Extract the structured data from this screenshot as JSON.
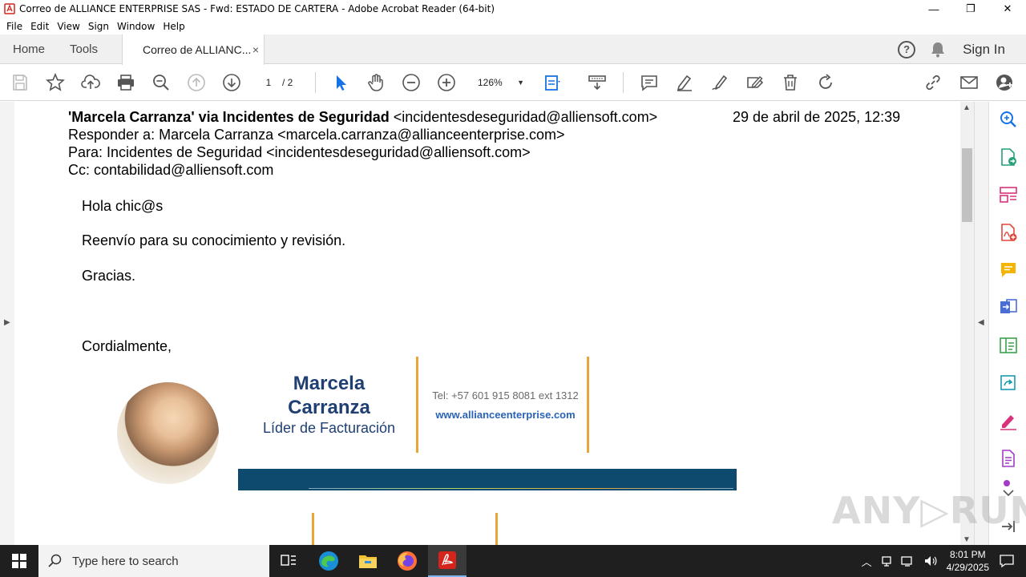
{
  "window": {
    "title": "Correo de ALLIANCE ENTERPRISE SAS - Fwd: ESTADO DE CARTERA - Adobe Acrobat Reader (64-bit)",
    "minimize": "—",
    "maximize": "❐",
    "close": "✕"
  },
  "menu": [
    "File",
    "Edit",
    "View",
    "Sign",
    "Window",
    "Help"
  ],
  "tabs": {
    "home": "Home",
    "tools": "Tools",
    "doc": "Correo de ALLIANC...",
    "close": "×"
  },
  "header": {
    "help": "?",
    "signin": "Sign In"
  },
  "toolbar": {
    "page_current": "1",
    "page_total": "/ 2",
    "zoom": "126%"
  },
  "email": {
    "from_bold": "'Marcela Carranza' via Incidentes de Seguridad",
    "from_addr": " <incidentesdeseguridad@alliensoft.com>",
    "date": "29 de abril de 2025, 12:39",
    "reply_to": "Responder a: Marcela Carranza <marcela.carranza@allianceenterprise.com>",
    "to": "Para: Incidentes de Seguridad <incidentesdeseguridad@alliensoft.com>",
    "cc": "Cc: contabilidad@alliensoft.com",
    "greeting": "Hola chic@s",
    "body": "Reenvío para su conocimiento y revisión.",
    "thanks": "Gracias.",
    "closing": "Cordialmente,"
  },
  "signature": {
    "name_line1": "Marcela",
    "name_line2": "Carranza",
    "role": "Líder de Facturación",
    "tel": "Tel: +57 601 915 8081 ext 1312",
    "web": "www.allianceenterprise.com",
    "accent_color": "#e7a53a",
    "name_color": "#1f3f73"
  },
  "watermark": "ANY▷RUN",
  "taskbar": {
    "search_placeholder": "Type here to search",
    "time": "8:01 PM",
    "date": "4/29/2025"
  },
  "colors": {
    "acrobat_red": "#d4241c",
    "toolbar_blue": "#1473e6",
    "taskbar": "#1f1f1f"
  }
}
